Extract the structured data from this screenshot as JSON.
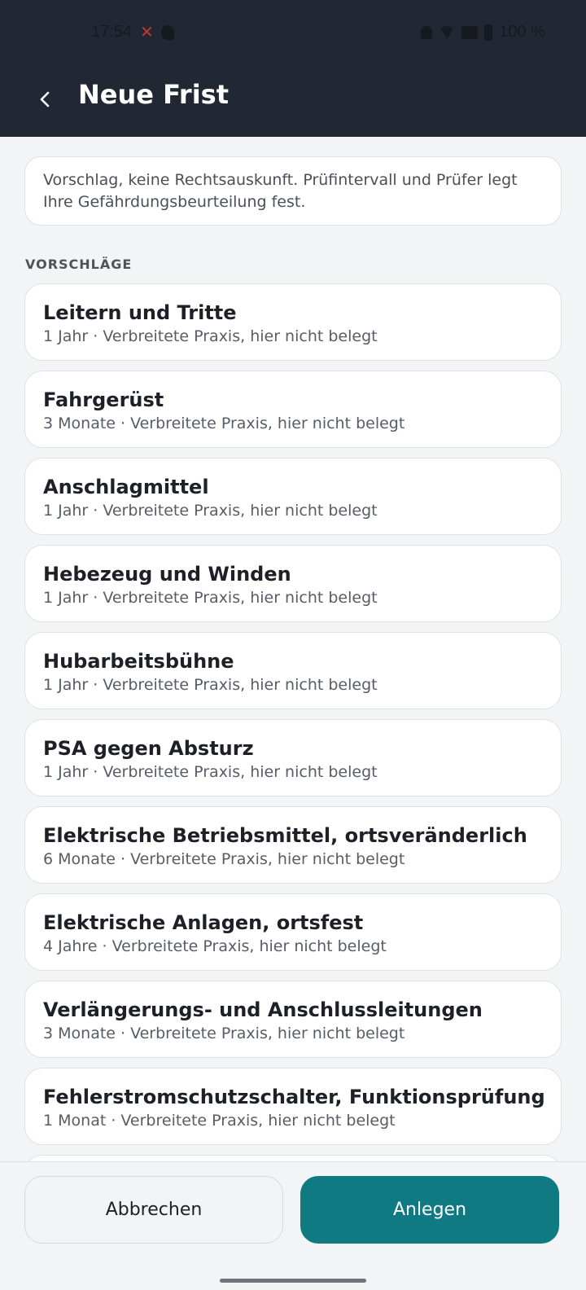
{
  "status_bar": {
    "time": "17:54",
    "battery": "100 %",
    "icons": [
      "missed-call-icon",
      "app-notification-icon",
      "bell-off-icon",
      "wifi-icon",
      "sim-icon",
      "battery-icon"
    ]
  },
  "app_bar": {
    "title": "Neue Frist",
    "back_icon": "chevron-left-icon"
  },
  "notice": {
    "text": "Vorschlag, keine Rechtsauskunft. Prüfintervall und Prüfer legt Ihre Gefährdungsbeurteilung fest."
  },
  "suggestions": {
    "section_label": "VORSCHLÄGE",
    "items": [
      {
        "title": "Leitern und Tritte",
        "subtitle": "1 Jahr · Verbreitete Praxis, hier nicht belegt"
      },
      {
        "title": "Fahrgerüst",
        "subtitle": "3 Monate · Verbreitete Praxis, hier nicht belegt"
      },
      {
        "title": "Anschlagmittel",
        "subtitle": "1 Jahr · Verbreitete Praxis, hier nicht belegt"
      },
      {
        "title": "Hebezeug und Winden",
        "subtitle": "1 Jahr · Verbreitete Praxis, hier nicht belegt"
      },
      {
        "title": "Hubarbeitsbühne",
        "subtitle": "1 Jahr · Verbreitete Praxis, hier nicht belegt"
      },
      {
        "title": "PSA gegen Absturz",
        "subtitle": "1 Jahr · Verbreitete Praxis, hier nicht belegt"
      },
      {
        "title": "Elektrische Betriebsmittel, ortsveränderlich",
        "subtitle": "6 Monate · Verbreitete Praxis, hier nicht belegt"
      },
      {
        "title": "Elektrische Anlagen, ortsfest",
        "subtitle": "4 Jahre · Verbreitete Praxis, hier nicht belegt"
      },
      {
        "title": "Verlängerungs- und Anschlussleitungen",
        "subtitle": "3 Monate · Verbreitete Praxis, hier nicht belegt"
      },
      {
        "title": "Fehlerstromschutzschalter, Funktionsprüfung",
        "subtitle": "1 Monat · Verbreitete Praxis, hier nicht belegt"
      }
    ]
  },
  "actions": {
    "cancel_label": "Abbrechen",
    "create_label": "Anlegen"
  },
  "colors": {
    "header": "#222833",
    "background": "#f2f4f6",
    "accent": "#107a82"
  }
}
